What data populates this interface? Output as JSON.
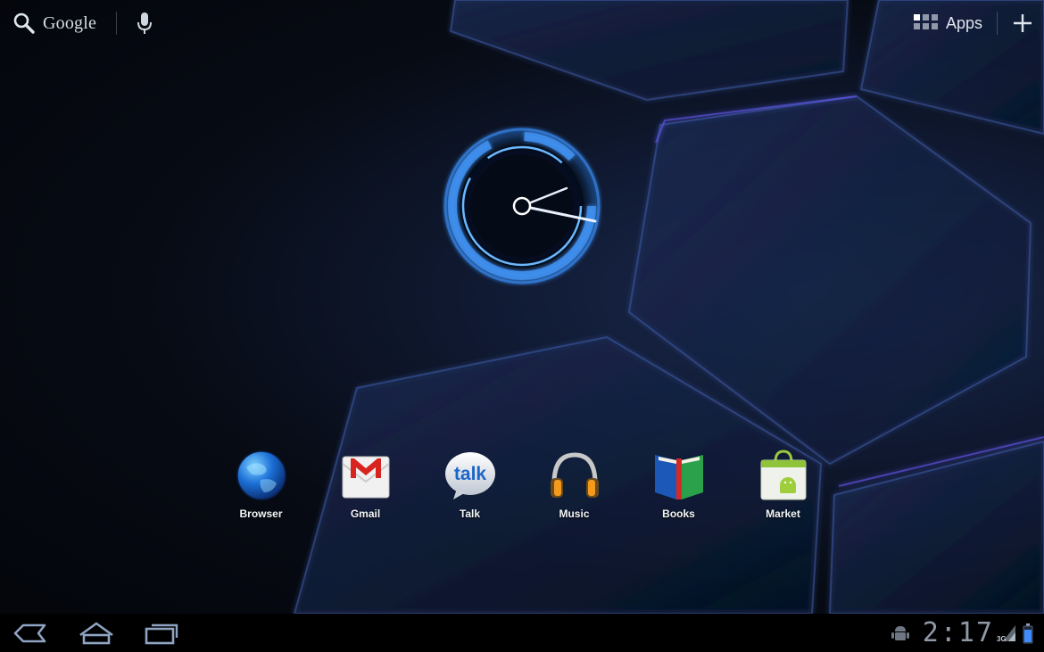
{
  "search": {
    "label": "Google"
  },
  "launcher": {
    "apps_label": "Apps"
  },
  "dock": {
    "apps": [
      {
        "label": "Browser"
      },
      {
        "label": "Gmail"
      },
      {
        "label": "Talk"
      },
      {
        "label": "Music"
      },
      {
        "label": "Books"
      },
      {
        "label": "Market"
      }
    ]
  },
  "talk_icon_text": "talk",
  "status": {
    "time": "2:17",
    "network": "3G"
  },
  "icons": [
    "search-icon",
    "microphone-icon",
    "apps-grid-icon",
    "add-icon",
    "clock-widget",
    "back-icon",
    "home-icon",
    "recent-apps-icon",
    "android-notification-icon",
    "signal-icon",
    "battery-icon"
  ],
  "colors": {
    "accent": "#3aa6ff",
    "clock_ring": "#4f9cf2",
    "system_bar": "#000000"
  }
}
